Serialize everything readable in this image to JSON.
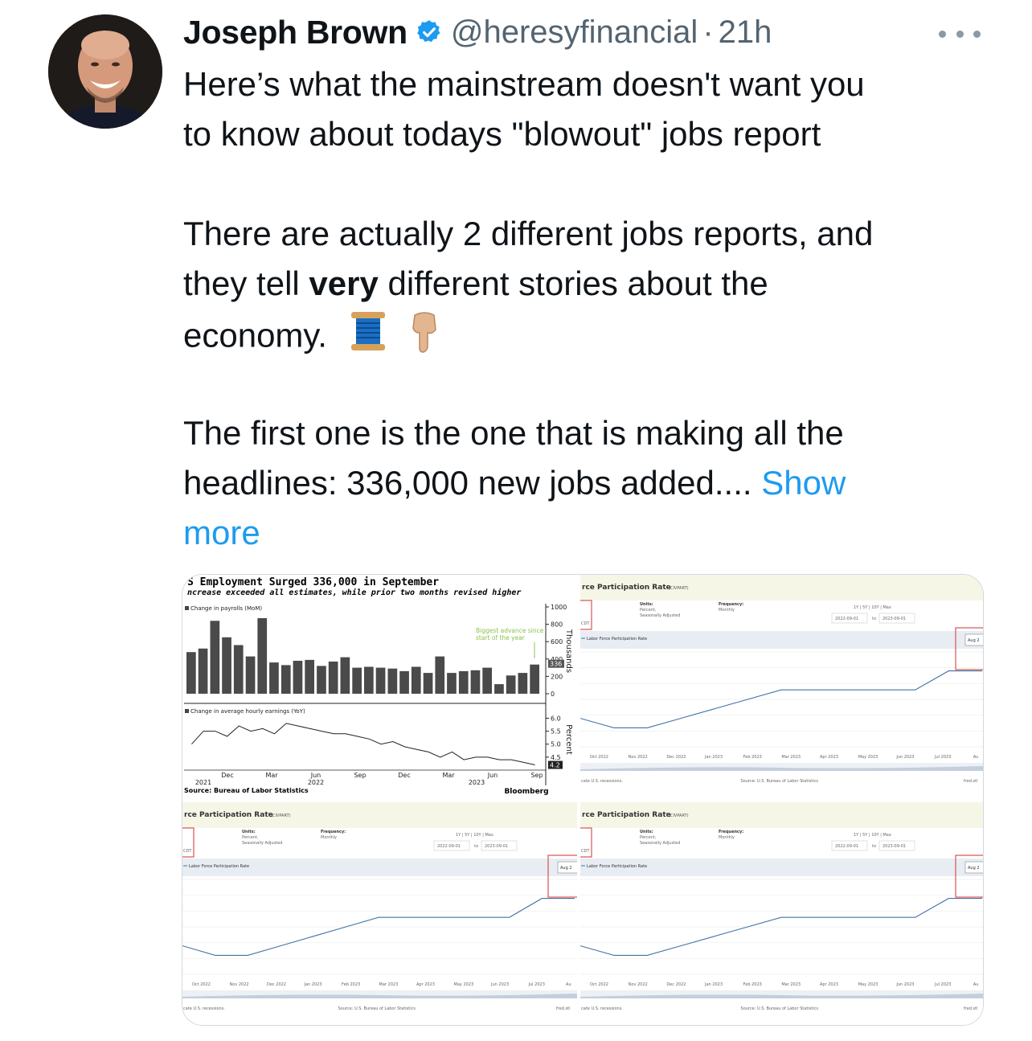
{
  "author": {
    "name": "Joseph Brown",
    "handle": "@heresyfinancial",
    "separator": "·",
    "time": "21h",
    "verified_color": "#1d9bf0"
  },
  "tweet": {
    "line1": "Here’s what the mainstream doesn't want you",
    "line2": "to know about todays \"blowout\" jobs report",
    "line3": "There are actually 2 different jobs reports, and",
    "line4_pre": "they tell ",
    "line4_bold": "very",
    "line4_post": " different stories about the",
    "line5": "economy.",
    "emoji_spool": "🧵",
    "emoji_point": "👇",
    "line6": "The first one is the one that is making all the",
    "line7": "headlines: 336,000 new jobs added....",
    "show_more_1": "Show",
    "show_more_2": "more"
  },
  "media": {
    "bloomberg": {
      "title": "S Employment Surged 336,000 in September",
      "subtitle": "ncrease exceeded all estimates, while prior two months revised higher",
      "legend_top": "Change in payrolls (MoM)",
      "legend_bottom": "Change in average hourly earnings (YoY)",
      "annotation_line1": "Biggest advance since",
      "annotation_line2": "start of the year",
      "axis_top_label": "Thousands",
      "axis_bottom_label": "Percent",
      "last_value_top": "336",
      "last_value_bottom": "4.2",
      "source": "Source: Bureau of Labor Statistics",
      "brand": "Bloomberg",
      "year_labels": [
        "2021",
        "2022",
        "2023"
      ]
    },
    "fred": {
      "title": "rce Participation Rate",
      "series_id": "(CIVPART)",
      "units_label": "Units:",
      "units_value1": "Percent,",
      "units_value2": "Seasonally Adjusted",
      "freq_label": "Frequency:",
      "freq_value": "Monthly",
      "range_links": "1Y | 5Y | 10Y | Max",
      "date_from": "2022-09-01",
      "date_to_word": "to",
      "date_to": "2023-09-01",
      "legend": "Labor Force Participation Rate",
      "tooltip": "Aug 2",
      "edt": "CDT",
      "x_ticks": [
        "Oct 2022",
        "Nov 2022",
        "Dec 2022",
        "Jan 2023",
        "Feb 2023",
        "Mar 2023",
        "Apr 2023",
        "May 2023",
        "Jun 2023",
        "Jul 2023",
        "Au"
      ],
      "recessions": "cate U.S. recessions.",
      "source": "Source: U.S. Bureau of Labor Statistics",
      "brand": "fred.stl"
    }
  },
  "chart_data": [
    {
      "type": "bar",
      "title": "S Employment Surged 336,000 in September",
      "ylabel": "Thousands",
      "ylim": [
        0,
        1000
      ],
      "x_ticks": [
        "Dec",
        "Mar",
        "Jun",
        "Sep",
        "Dec",
        "Mar",
        "Jun",
        "Sep"
      ],
      "values": [
        480,
        520,
        840,
        650,
        560,
        430,
        870,
        360,
        330,
        380,
        390,
        320,
        370,
        420,
        300,
        310,
        300,
        290,
        260,
        310,
        240,
        430,
        240,
        260,
        270,
        300,
        110,
        210,
        240,
        336
      ],
      "y_ticks": [
        "1000",
        "800",
        "600",
        "400",
        "200",
        "0"
      ]
    },
    {
      "type": "line",
      "title": "Change in average hourly earnings (YoY)",
      "ylabel": "Percent",
      "ylim": [
        4.0,
        6.2
      ],
      "x_ticks": [
        "Dec",
        "Mar",
        "Jun",
        "Sep",
        "Dec",
        "Mar",
        "Jun",
        "Sep"
      ],
      "values": [
        5.0,
        5.5,
        5.5,
        5.3,
        5.7,
        5.5,
        5.6,
        5.4,
        5.8,
        5.7,
        5.6,
        5.5,
        5.4,
        5.4,
        5.3,
        5.2,
        5.0,
        5.1,
        4.9,
        4.8,
        4.7,
        4.5,
        4.7,
        4.4,
        4.5,
        4.5,
        4.4,
        4.4,
        4.3,
        4.2
      ],
      "y_ticks": [
        "6.0",
        "5.5",
        "5.0",
        "4.5"
      ]
    },
    {
      "type": "line",
      "title": "Labor Force Participation Rate",
      "ylabel": "Percent",
      "x": [
        "2022-09",
        "2022-10",
        "2022-11",
        "2022-12",
        "2023-01",
        "2023-02",
        "2023-03",
        "2023-04",
        "2023-05",
        "2023-06",
        "2023-07",
        "2023-08",
        "2023-09"
      ],
      "values": [
        62.3,
        62.2,
        62.2,
        62.3,
        62.4,
        62.5,
        62.6,
        62.6,
        62.6,
        62.6,
        62.6,
        62.8,
        62.8
      ],
      "ylim": [
        62.0,
        63.0
      ]
    }
  ]
}
